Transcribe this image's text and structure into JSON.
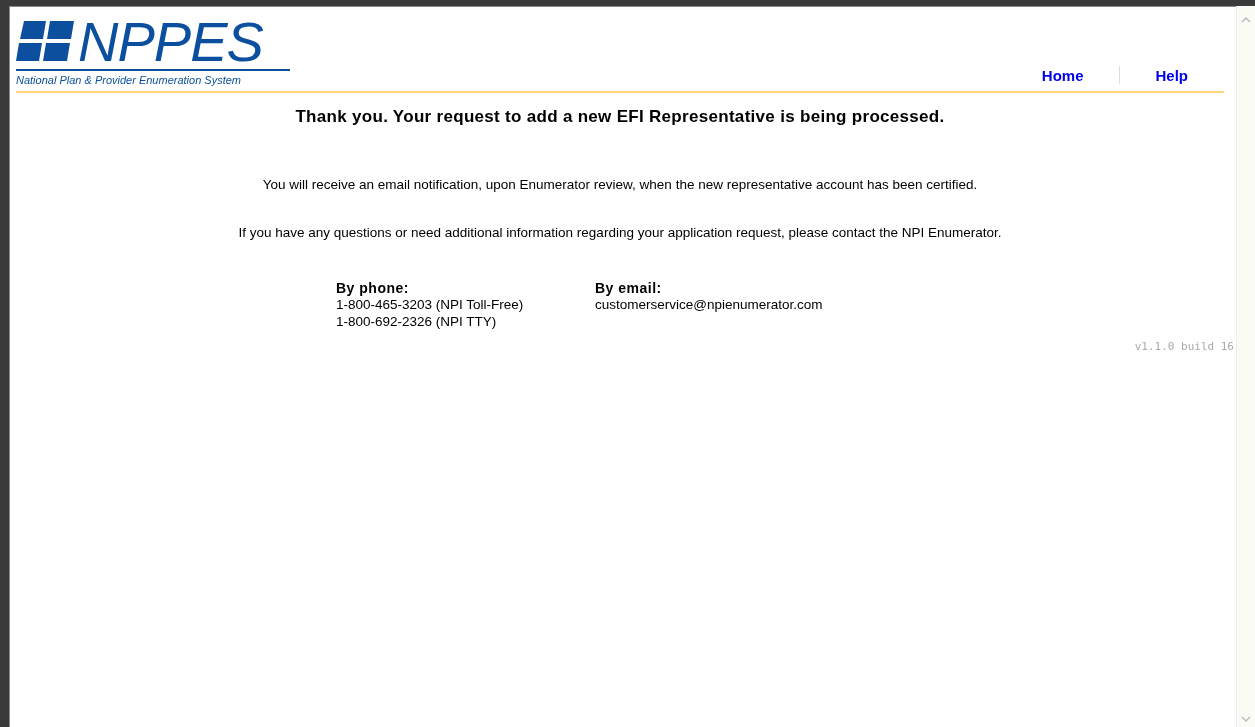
{
  "logo": {
    "title": "NPPES",
    "subtitle": "National Plan & Provider Enumeration System"
  },
  "nav": [
    {
      "label": "Home"
    },
    {
      "label": "Help"
    }
  ],
  "heading": "Thank you. Your request to add a new EFI Representative is being processed.",
  "paragraphs": [
    "You will receive an email notification, upon Enumerator review, when the new representative account has been certified.",
    "If you have any questions or need additional information regarding your application request, please contact the NPI Enumerator."
  ],
  "contacts": [
    {
      "title": "By phone:",
      "lines": [
        "1-800-465-3203 (NPI Toll-Free)",
        "1-800-692-2326 (NPI TTY)"
      ]
    },
    {
      "title": "By email:",
      "lines": [
        "customerservice@npienumerator.com"
      ]
    }
  ],
  "version": "v1.1.0 build 16"
}
